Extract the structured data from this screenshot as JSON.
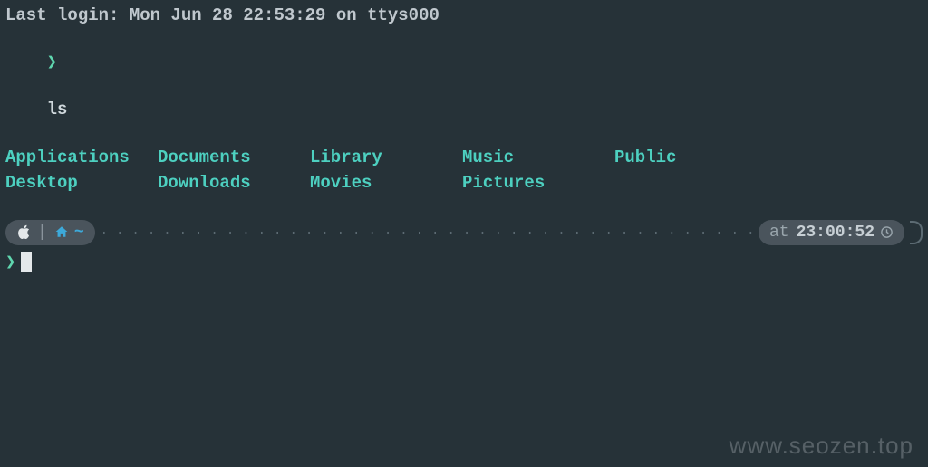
{
  "login_line": "Last login: Mon Jun 28 22:53:29 on ttys000",
  "prompt1": {
    "symbol": "❯",
    "command": "ls"
  },
  "ls": {
    "items": [
      "Applications",
      "Documents",
      "Library",
      "Music",
      "Public",
      "Desktop",
      "Downloads",
      "Movies",
      "Pictures"
    ]
  },
  "status": {
    "os_icon": "apple",
    "home_icon": "home",
    "path": "~",
    "at_label": "at",
    "time": "23:00:52",
    "clock_icon": "clock"
  },
  "prompt2": {
    "symbol": "❯"
  },
  "watermark": "www.seozen.top"
}
